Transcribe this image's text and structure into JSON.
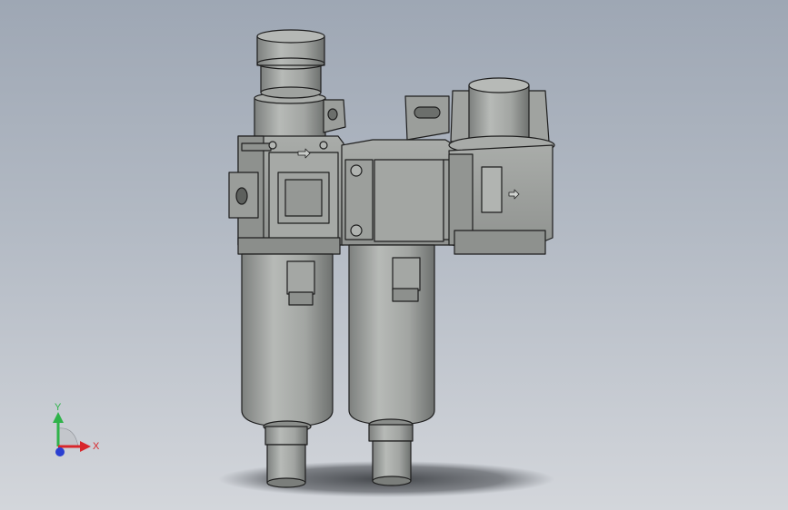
{
  "viewport": {
    "background_top": "#9ea7b4",
    "background_bottom": "#d3d6db",
    "part_color": "#9a9d9a",
    "edge_color": "#1e1e1e"
  },
  "triad": {
    "x_label": "X",
    "y_label": "Y",
    "x_color": "#d8262b",
    "y_color": "#2fb34a",
    "z_color": "#2a3fd1",
    "icon": "coordinate-triad-icon"
  }
}
